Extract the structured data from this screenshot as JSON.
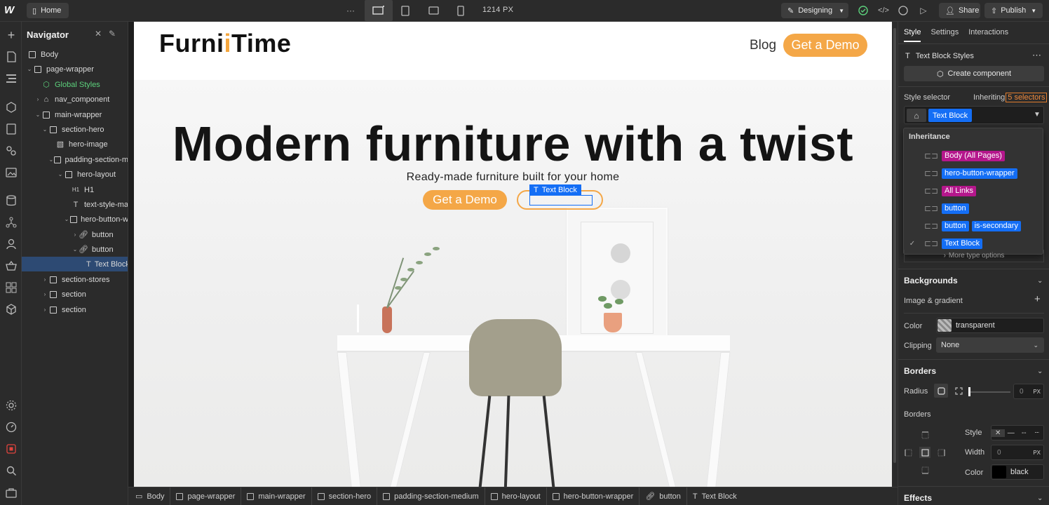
{
  "topbar": {
    "logo_text": "W",
    "page_button_label": "Home",
    "width_readout": "1214 PX",
    "mode_label": "Designing",
    "share_label": "Share",
    "publish_label": "Publish"
  },
  "navigator": {
    "title": "Navigator",
    "tree": [
      {
        "label": "Body"
      },
      {
        "label": "page-wrapper"
      },
      {
        "label": "Global Styles"
      },
      {
        "label": "nav_component"
      },
      {
        "label": "main-wrapper"
      },
      {
        "label": "section-hero"
      },
      {
        "label": "hero-image"
      },
      {
        "label": "padding-section-m"
      },
      {
        "label": "hero-layout"
      },
      {
        "label": "H1"
      },
      {
        "label": "text-style-ma"
      },
      {
        "label": "hero-button-w"
      },
      {
        "label": "button"
      },
      {
        "label": "button"
      },
      {
        "label": "Text Block"
      },
      {
        "label": "section-stores"
      },
      {
        "label": "section"
      },
      {
        "label": "section"
      }
    ]
  },
  "site": {
    "logo_a": "Furni",
    "logo_i": "T",
    "logo_b": "ime",
    "logo_dot": "i",
    "nav_blog": "Blog",
    "nav_cta": "Get a Demo",
    "hero_title": "Modern furniture with a twist",
    "hero_subtitle": "Ready-made furniture built for your home",
    "hero_button": "Get a Demo",
    "selected_label": "Text Block"
  },
  "breadcrumb": [
    "Body",
    "page-wrapper",
    "main-wrapper",
    "section-hero",
    "padding-section-medium",
    "hero-layout",
    "hero-button-wrapper",
    "button",
    "Text Block"
  ],
  "right_panel": {
    "tabs": [
      "Style",
      "Settings",
      "Interactions"
    ],
    "styles_title": "Text Block Styles",
    "create_component": "Create component",
    "style_selector_label": "Style selector",
    "inheriting_label": "Inheriting",
    "inheriting_count": "5 selectors",
    "selector_chip": "Text Block",
    "inheritance_title": "Inheritance",
    "inheritance": [
      {
        "chips": [
          "Body (All Pages)"
        ],
        "color": "pink"
      },
      {
        "chips": [
          "hero-button-wrapper"
        ],
        "color": "blue"
      },
      {
        "chips": [
          "All Links"
        ],
        "color": "pink"
      },
      {
        "chips": [
          "button"
        ],
        "color": "blue"
      },
      {
        "chips": [
          "button",
          "is-secondary"
        ],
        "color": "blue"
      },
      {
        "chips": [
          "Text Block"
        ],
        "color": "blue"
      }
    ],
    "more_type_options": "More type options",
    "backgrounds": {
      "title": "Backgrounds",
      "image_gradient": "Image & gradient",
      "color_label": "Color",
      "color_value": "transparent",
      "clipping_label": "Clipping",
      "clipping_value": "None"
    },
    "borders": {
      "title": "Borders",
      "radius_label": "Radius",
      "radius_value": "0",
      "radius_unit": "PX",
      "borders_label": "Borders",
      "style_label": "Style",
      "width_label": "Width",
      "width_value": "0",
      "width_unit": "PX",
      "color_label": "Color",
      "color_value": "black"
    },
    "effects_title": "Effects"
  },
  "colors": {
    "accent": "#146ef5",
    "brand_orange": "#f4a747",
    "pink_chip": "#b5178c"
  }
}
